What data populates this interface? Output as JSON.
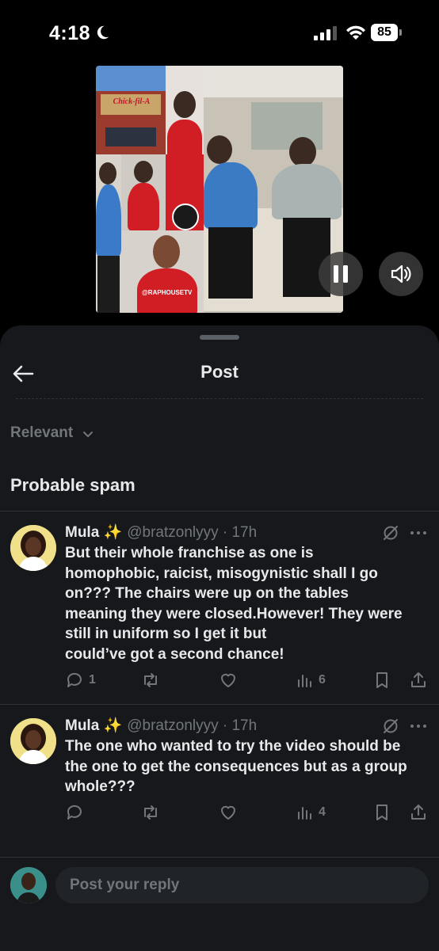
{
  "status_bar": {
    "time": "4:18",
    "battery": "85"
  },
  "video": {
    "sign_text": "Chick-fil-A",
    "watermark": "@RAPHOUSETV",
    "pause_icon": "pause-icon",
    "sound_icon": "speaker-on-icon"
  },
  "header": {
    "title": "Post",
    "back_icon": "arrow-left-icon"
  },
  "filter": {
    "label": "Relevant"
  },
  "section": {
    "title": "Probable spam"
  },
  "replies": [
    {
      "name": "Mula ✨",
      "handle": "@bratzonlyyy · 17h",
      "text": "But their whole franchise as one is\nhomophobic, raicist, misogynistic shall I go\non??? The chairs were up on the tables\nmeaning they were closed.However! They were\nstill in uniform so I get it but\n could’ve got a second chance!",
      "reply_count": "1",
      "retweet_count": "",
      "like_count": "",
      "view_count": "6"
    },
    {
      "name": "Mula ✨",
      "handle": "@bratzonlyyy · 17h",
      "text": "The one who wanted to try the video should be\nthe one to get the consequences but as a group\nwhole???",
      "reply_count": "",
      "retweet_count": "",
      "like_count": "",
      "view_count": "4"
    }
  ],
  "compose": {
    "placeholder": "Post your reply"
  },
  "colors": {
    "background": "#000000",
    "sheet": "#16181c",
    "muted_text": "#71767b",
    "text": "#e7e9ea",
    "divider": "#2f3336"
  }
}
